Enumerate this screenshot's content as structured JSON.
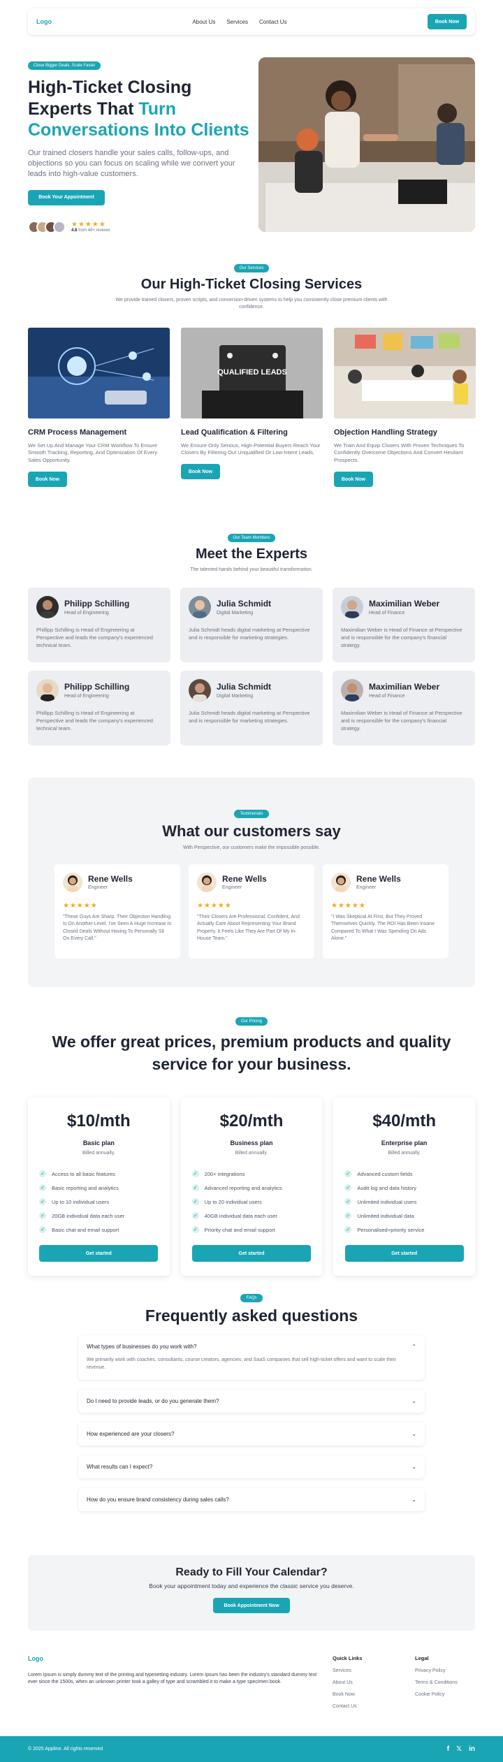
{
  "nav": {
    "logo": "Logo",
    "links": [
      "About Us",
      "Services",
      "Contact Us"
    ],
    "cta": "Book Now"
  },
  "hero": {
    "badge": "Close Bigger Deals. Scale Faster",
    "title_part1": "High-Ticket Closing Experts That ",
    "title_accent": "Turn Conversations Into Clients",
    "subtitle": "Our trained closers handle your sales calls, follow-ups, and objections so you can focus on scaling while we convert your leads into high-value customers.",
    "cta": "Book Your Appointment",
    "rating_value": "4.8",
    "rating_text": "from 48+ reviews",
    "stars": "★★★★★"
  },
  "services": {
    "badge": "Our Services",
    "title": "Our High-Ticket Closing Services",
    "subtitle": "We provide trained closers, proven scripts, and conversion-driven systems to help you consistently close premium clients with confidence.",
    "items": [
      {
        "title": "CRM  Process Management",
        "text": "We Set Up And Manage Your CRM Workflow To Ensure Smooth Tracking, Reporting, And Optimization Of Every Sales Opportunity.",
        "cta": "Book Now"
      },
      {
        "title": "Lead Qualification & Filtering",
        "text": "We Ensure Only Serious, High-Potential Buyers Reach Your Closers By Filtering Out Unqualified Or Low-Intent Leads.",
        "cta": "Book Now",
        "image_text": "QUALIFIED LEADS"
      },
      {
        "title": "Objection Handling Strategy",
        "text": "We Train And Equip Closers With Proven Techniques To Confidently Overcome Objections And Convert Hesitant Prospects.",
        "cta": "Book Now"
      }
    ]
  },
  "experts": {
    "badge": "Our Team Members",
    "title": "Meet the Experts",
    "subtitle": "The talented hands behind your beautiful transformation.",
    "items": [
      {
        "name": "Philipp Schilling",
        "role": "Head of Engineering",
        "text": "Phillipp Schilling is Head of Engineering at Perspective and leads the company's experienced technical team."
      },
      {
        "name": "Julia Schmidt",
        "role": "Digital Marketing",
        "text": "Julia Schmidt heads digital marketing at Perspective and is responsible for marketing strategies."
      },
      {
        "name": "Maximilian Weber",
        "role": "Head of Finance",
        "text": "Maximilian Weber is Head of Finance at Perspective and is responsible for the company's financial strategy."
      },
      {
        "name": "Philipp Schilling",
        "role": "Head of Engineering",
        "text": "Phillipp Schilling is Head of Engineering at Perspective and leads the company's experienced technical team."
      },
      {
        "name": "Julia Schmidt",
        "role": "Digital Marketing",
        "text": "Julia Schmidt heads digital marketing at Perspective and is responsible for marketing strategies."
      },
      {
        "name": "Maximilian Weber",
        "role": "Head of Finance",
        "text": "Maximilian Weber is Head of Finance at Perspective and is responsible for the company's financial strategy."
      }
    ]
  },
  "testimonials": {
    "badge": "Testimonials",
    "title": "What our customers say",
    "subtitle": "With Perspective, our customers make the impossible possible.",
    "items": [
      {
        "name": "Rene Wells",
        "role": "Engineer",
        "stars": "★★★★★",
        "text": "\"These Guys Are Sharp. Their Objection Handling Is On Another Level. I've Seen A Huge Increase In Closed Deals Without Having To Personally Sit On Every Call.\""
      },
      {
        "name": "Rene Wells",
        "role": "Engineer",
        "stars": "★★★★★",
        "text": "\"Their Closers Are Professional, Confident, And Actually Care About Representing Your Brand Properly. It Feels Like They Are Part Of My In-House Team.\""
      },
      {
        "name": "Rene Wells",
        "role": "Engineer",
        "stars": "★★★★★",
        "text": "\"I Was Skeptical At First, But They Proved Themselves Quickly. The ROI Has Been Insane Compared To What I Was Spending On Ads Alone.\""
      }
    ]
  },
  "pricing": {
    "badge": "Our Pricing",
    "title": "We offer great prices, premium products and quality service for your business.",
    "plans": [
      {
        "price": "$10/mth",
        "name": "Basic plan",
        "billed": "Billed annually.",
        "features": [
          "Access to all basic features",
          "Basic reporting and analytics",
          "Up to 10 individual users",
          "20GB individual data each user",
          "Basic chat and email support"
        ],
        "cta": "Get started"
      },
      {
        "price": "$20/mth",
        "name": "Business plan",
        "billed": "Billed annually.",
        "features": [
          "200+ integrations",
          "Advanced reporting and analytics",
          "Up to 20 individual users",
          "40GB individual data each user",
          "Priority chat and email support"
        ],
        "cta": "Get started"
      },
      {
        "price": "$40/mth",
        "name": "Enterprise plan",
        "billed": "Billed annually.",
        "features": [
          "Advanced custom fields",
          "Audit log and data history",
          "Unlimited individual users",
          "Unlimited individual data",
          "Personalised+priority service"
        ],
        "cta": "Get started"
      }
    ]
  },
  "faq": {
    "badge": "FAQs",
    "title": "Frequently asked questions",
    "items": [
      {
        "q": "What types of businesses do you work with?",
        "a": "We primarily work with coaches, consultants, course creators, agencies, and SaaS companies that sell high-ticket offers and want to scale their revenue.",
        "icon": "⌃"
      },
      {
        "q": "Do I need to provide leads, or do you generate them?",
        "a": "",
        "icon": "⌄"
      },
      {
        "q": "How experienced are your closers?",
        "a": "",
        "icon": "⌄"
      },
      {
        "q": "What results can I expect?",
        "a": "",
        "icon": "⌄"
      },
      {
        "q": "How do you ensure brand consistency during sales calls?",
        "a": "",
        "icon": "⌄"
      }
    ]
  },
  "cta": {
    "title": "Ready to Fill Your Calendar?",
    "subtitle": "Book your appointment today and experience the classic service you deserve.",
    "button": "Book Appointment Now"
  },
  "footer": {
    "logo": "Logo",
    "text": "Lorem Ipsum is simply dummy text of the printing and typesetting industry. Lorem Ipsum has been the industry's standard dummy text ever since the 1500s, when an unknown printer took a galley of type and scrambled it to make a type specimen book.",
    "quick_links_title": "Quick Links",
    "quick_links": [
      "Services",
      "About Us",
      "Book Now",
      "Contact Us"
    ],
    "legal_title": "Legal",
    "legal": [
      "Privacy Policy",
      "Terms & Conditions",
      "Cookie Policy"
    ],
    "copyright": "© 2025 Appline. All rights reserved",
    "social": [
      "f",
      "𝕏",
      "in"
    ]
  },
  "colors": {
    "accent": "#1aa5b5",
    "star": "#f5a623",
    "text": "#1f2433",
    "muted": "#6b7280"
  }
}
